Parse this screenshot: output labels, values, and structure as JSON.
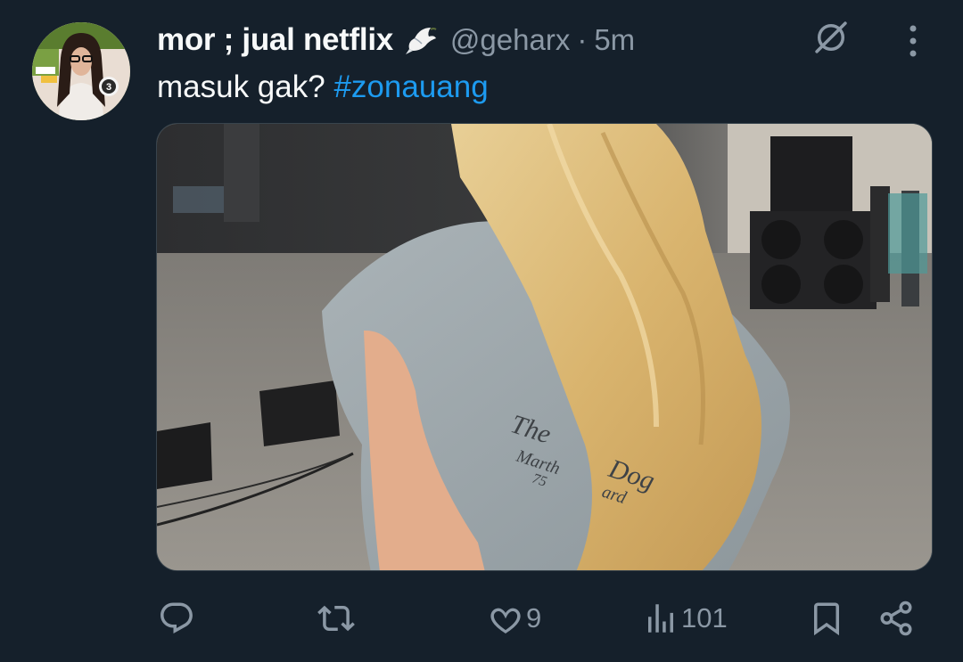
{
  "tweet": {
    "display_name": "mor ; jual netflix",
    "handle": "@geharx",
    "separator": "·",
    "time": "5m",
    "text_plain": "masuk gak?",
    "hashtag": "#zonauang",
    "avatar_badge": "3",
    "image_shirt_text": [
      "The",
      "Dog",
      "Marth",
      "ard",
      "75"
    ]
  },
  "actions": {
    "reply_count": "",
    "retweet_count": "",
    "like_count": "9",
    "views_count": "101"
  },
  "colors": {
    "background": "#15202b",
    "text_primary": "#f7f9f9",
    "text_secondary": "#8b98a5",
    "link": "#1d9bf0"
  },
  "icons": {
    "dove": "dove-emoji-icon",
    "grok": "grok-icon",
    "more": "more-vertical-icon",
    "reply": "reply-icon",
    "retweet": "retweet-icon",
    "like": "heart-icon",
    "views": "views-chart-icon",
    "bookmark": "bookmark-icon",
    "share": "share-icon"
  }
}
